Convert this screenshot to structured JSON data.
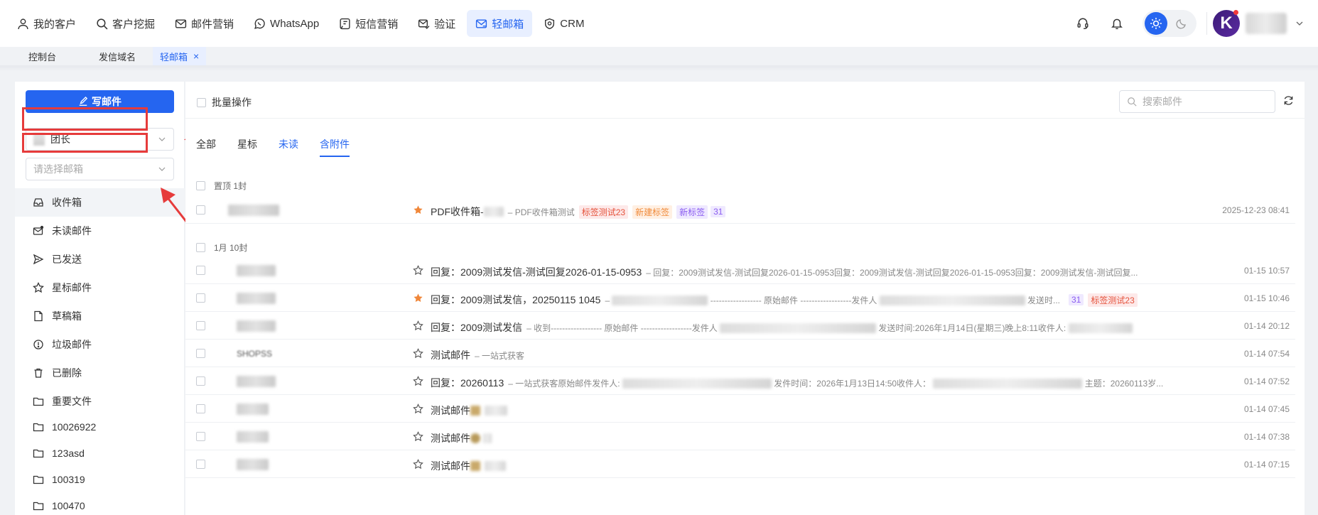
{
  "nav": {
    "items": [
      {
        "label": "我的客户",
        "icon": "user-icon"
      },
      {
        "label": "客户挖掘",
        "icon": "search-icon"
      },
      {
        "label": "邮件营销",
        "icon": "mail-icon"
      },
      {
        "label": "WhatsApp",
        "icon": "whatsapp-icon"
      },
      {
        "label": "短信营销",
        "icon": "sms-icon"
      },
      {
        "label": "验证",
        "icon": "verify-mail-icon"
      },
      {
        "label": "轻邮箱",
        "icon": "light-mail-icon",
        "active": true
      },
      {
        "label": "CRM",
        "icon": "crm-icon"
      }
    ]
  },
  "avatar_letter": "K",
  "tabs": {
    "console": "控制台",
    "domain": "发信域名",
    "mailbox": "轻邮箱",
    "close": "×"
  },
  "sidebar": {
    "compose_label": "写邮件",
    "account_select": "团长",
    "mailbox_placeholder": "请选择邮箱",
    "folders": [
      {
        "label": "收件箱",
        "icon": "inbox-icon"
      },
      {
        "label": "未读邮件",
        "icon": "unread-mail-icon"
      },
      {
        "label": "已发送",
        "icon": "sent-icon"
      },
      {
        "label": "星标邮件",
        "icon": "star-icon"
      },
      {
        "label": "草稿箱",
        "icon": "draft-icon"
      },
      {
        "label": "垃圾邮件",
        "icon": "spam-icon"
      },
      {
        "label": "已删除",
        "icon": "trash-icon"
      },
      {
        "label": "重要文件",
        "icon": "folder-icon"
      },
      {
        "label": "10026922",
        "icon": "folder-icon"
      },
      {
        "label": "123asd",
        "icon": "folder-icon"
      },
      {
        "label": "100319",
        "icon": "folder-icon"
      },
      {
        "label": "100470",
        "icon": "folder-icon"
      }
    ]
  },
  "toolbar": {
    "bulk_label": "批量操作",
    "search_placeholder": "搜索邮件"
  },
  "filters": {
    "all": "全部",
    "starred": "星标",
    "unread": "未读",
    "attachments": "含附件"
  },
  "groups": {
    "pinned": "置顶 1封",
    "january": "1月 10封"
  },
  "emails": [
    {
      "subject": "PDF收件箱-",
      "snippet": "PDF收件箱测试",
      "starred": true,
      "time": "2025-12-23 08:41",
      "tags": [
        "标签测试23",
        "新建标签",
        "新标签",
        "31"
      ]
    },
    {
      "subject": "回复：2009测试发信-测试回复2026-01-15-0953",
      "snippet": "回复：2009测试发信-测试回复2026-01-15-0953回复：2009测试发信-测试回复2026-01-15-0953回复：2009测试发信-测试回复...",
      "starred": false,
      "time": "01-15 10:57"
    },
    {
      "subject": "回复：2009测试发信，20250115 1045",
      "snippet_a": "------------------ 原始邮件 ------------------发件人",
      "snippet_b": "发送时...",
      "starred": true,
      "time": "01-15 10:46",
      "tags": [
        "31",
        "标签测试23"
      ]
    },
    {
      "subject": "回复：2009测试发信",
      "snippet_a": "收到------------------ 原始邮件 ------------------发件人",
      "snippet_b": "发送时间:2026年1月14日(星期三)晚上8:11收件人:",
      "starred": false,
      "time": "01-14 20:12"
    },
    {
      "subject": "测试邮件",
      "snippet": "一站式获客",
      "sender": "SHOPSS",
      "starred": false,
      "time": "01-14 07:54"
    },
    {
      "subject": "回复：20260113",
      "snippet_a": "一站式获客原始邮件发件人:",
      "snippet_b": "发件时间：2026年1月13日14:50收件人：",
      "snippet_c": "主题：20260113岁...",
      "starred": false,
      "time": "01-14 07:52"
    },
    {
      "subject": "测试邮件",
      "starred": false,
      "time": "01-14 07:45"
    },
    {
      "subject": "测试邮件",
      "starred": false,
      "time": "01-14 07:38"
    },
    {
      "subject": "测试邮件",
      "starred": false,
      "time": "01-14 07:15"
    }
  ],
  "colors": {
    "accent": "#2565f0",
    "star_active": "#f0873a",
    "annotation": "#e63b3b"
  }
}
